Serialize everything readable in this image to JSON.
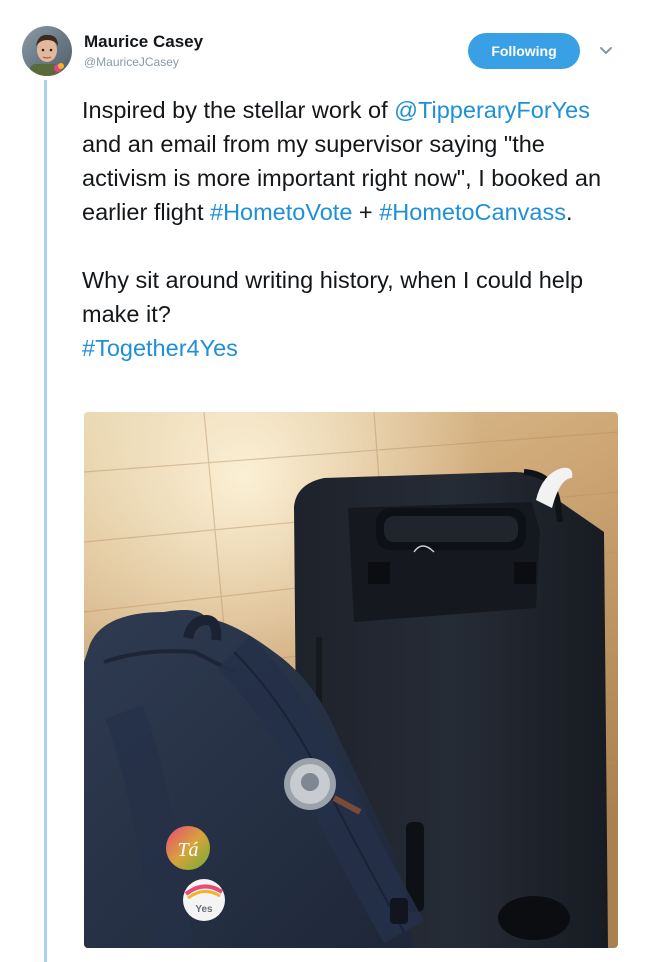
{
  "author": {
    "name": "Maurice Casey",
    "handle": "@MauriceJCasey"
  },
  "follow_button": {
    "label": "Following"
  },
  "tweet": {
    "paragraph1": {
      "part1": "Inspired by the stellar work of ",
      "mention": "@TipperaryForYes",
      "part2": " and an email from my supervisor saying \"the activism is more important right now\", I booked an earlier flight ",
      "hashtag1": "#HometoVote",
      "part3": " + ",
      "hashtag2": "#HometoCanvass",
      "part4": "."
    },
    "paragraph2": {
      "text": "Why sit around writing history, when I could help make it?",
      "hashtag": "#Together4Yes"
    }
  },
  "photo": {
    "badge1_text": "Tá",
    "badge2_text": "Yes"
  },
  "colors": {
    "link": "#1f8fd6",
    "follow_button": "#3aa0e5",
    "thread_line": "#a8d4f2"
  },
  "icons": {
    "menu": "chevron-down-icon"
  }
}
